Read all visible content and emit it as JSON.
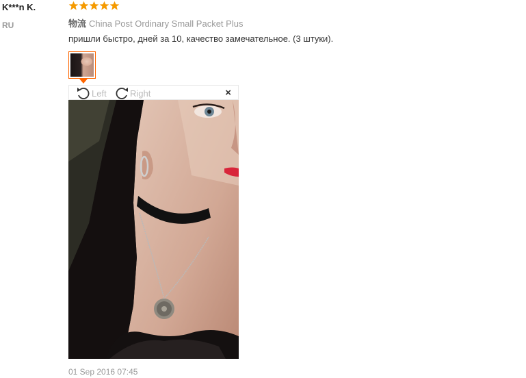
{
  "reviewer": {
    "name": "K***n K.",
    "country": "RU"
  },
  "rating": {
    "stars": 5,
    "max": 5,
    "color": "#f59a00"
  },
  "shipping": {
    "label": "物流",
    "method": "China Post Ordinary Small Packet Plus"
  },
  "review": {
    "text": "пришли быстро, дней за 10, качество замечательное. (3 штуки)."
  },
  "viewer": {
    "rotate_left_label": "Left",
    "rotate_right_label": "Right",
    "close_label": "×"
  },
  "date": "01 Sep 2016 07:45",
  "colors": {
    "accent": "#ff6600",
    "muted": "#999999"
  }
}
